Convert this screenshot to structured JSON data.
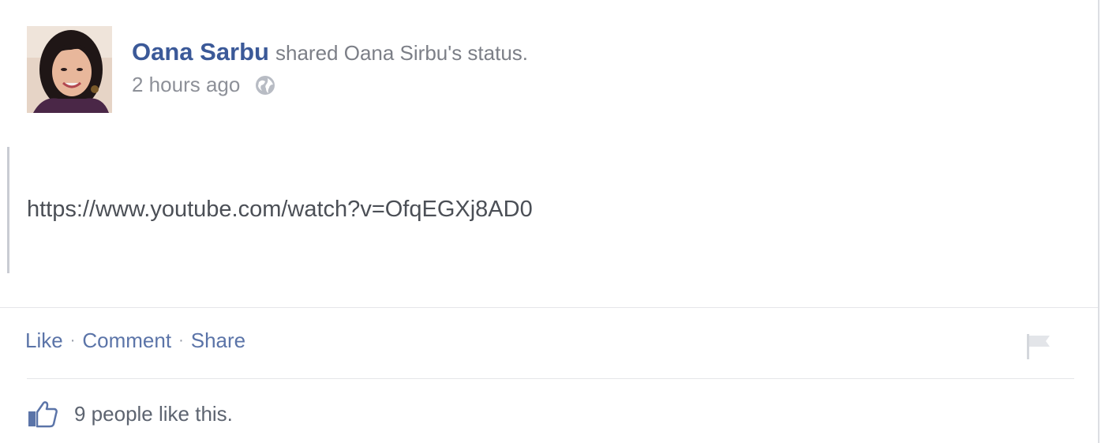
{
  "post": {
    "author_name": "Oana Sarbu",
    "action_text": "shared Oana Sirbu's status.",
    "timestamp": "2 hours ago",
    "privacy_icon": "globe-icon",
    "shared_link": "https://www.youtube.com/watch?v=OfqEGXj8AD0"
  },
  "actions": {
    "like_label": "Like",
    "comment_label": "Comment",
    "share_label": "Share",
    "separator": "·",
    "report_icon": "flag-icon"
  },
  "likes": {
    "icon": "thumbs-up-icon",
    "text": "9 people like this."
  },
  "colors": {
    "link_blue": "#3b5998",
    "action_blue": "#5b74a8",
    "muted_text": "#8d9098",
    "divider": "#e5e6e9"
  }
}
